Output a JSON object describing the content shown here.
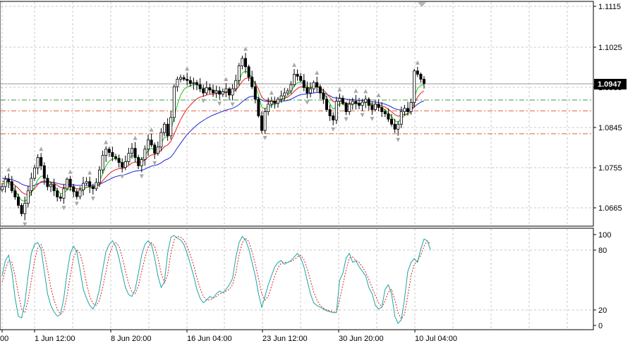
{
  "chart_data": [
    {
      "type": "candlestick",
      "y_ticks": [
        "1.1115",
        "1.1025",
        "1.0935",
        "1.0845",
        "1.0755",
        "1.0665"
      ],
      "ylim": [
        1.0605,
        1.1145
      ],
      "current_price_label": "1.0947",
      "current_price": 1.0947,
      "horizontal_levels": [
        {
          "price": 1.0908,
          "color": "#3c9a3c",
          "style": "dash-dot"
        },
        {
          "price": 1.0882,
          "color": "#e0623a",
          "style": "dash-dot"
        },
        {
          "price": 1.0827,
          "color": "#e0623a",
          "style": "dash-dot"
        }
      ],
      "x_labels": [
        "00",
        "1 Jun 12:00",
        "8 Jun 20:00",
        "16 Jun 04:00",
        "23 Jun 12:00",
        "30 Jun 20:00",
        "10 Jul 04:00"
      ],
      "closes": [
        1.07,
        1.0718,
        1.0712,
        1.069,
        1.0675,
        1.0655,
        1.0635,
        1.066,
        1.069,
        1.072,
        1.0745,
        1.077,
        1.075,
        1.072,
        1.07,
        1.0705,
        1.069,
        1.0675,
        1.0672,
        1.0695,
        1.0718,
        1.07,
        1.0688,
        1.0676,
        1.0692,
        1.0708,
        1.0712,
        1.07,
        1.0695,
        1.071,
        1.074,
        1.0775,
        1.079,
        1.0782,
        1.0772,
        1.0768,
        1.0758,
        1.0746,
        1.076,
        1.078,
        1.0792,
        1.077,
        1.075,
        1.0765,
        1.079,
        1.0812,
        1.08,
        1.078,
        1.0795,
        1.083,
        1.085,
        1.0822,
        1.0866,
        1.094,
        1.0958,
        1.0962,
        1.0958,
        1.0955,
        1.0948,
        1.095,
        1.0945,
        1.0935,
        1.0925,
        1.0938,
        1.0932,
        1.0925,
        1.093,
        1.0922,
        1.0928,
        1.0935,
        1.092,
        1.0935,
        1.0955,
        1.099,
        1.1008,
        1.0988,
        1.0963,
        1.094,
        1.091,
        1.087,
        1.0835,
        1.088,
        1.0898,
        1.0905,
        1.09,
        1.091,
        1.0918,
        1.0925,
        1.093,
        1.0945,
        1.097,
        1.0965,
        1.0955,
        1.0938,
        1.0925,
        1.0935,
        1.095,
        1.094,
        1.0925,
        1.091,
        1.0885,
        1.087,
        1.086,
        1.0905,
        1.0912,
        1.09,
        1.088,
        1.0898,
        1.0905,
        1.09,
        1.0895,
        1.0903,
        1.091,
        1.0895,
        1.0885,
        1.0898,
        1.089,
        1.088,
        1.0875,
        1.0862,
        1.085,
        1.0838,
        1.085,
        1.088,
        1.0888,
        1.088,
        1.0902,
        1.0978,
        1.097,
        1.0958,
        1.0948
      ],
      "ma_fast": [
        1.0706,
        1.071,
        1.0709,
        1.0701,
        1.0691,
        1.0678,
        1.0667,
        1.0665,
        1.067,
        1.0684,
        1.07,
        1.0716,
        1.0725,
        1.0725,
        1.0716,
        1.071,
        1.0702,
        1.0692,
        1.0683,
        1.0684,
        1.0692,
        1.0694,
        1.0691,
        1.0685,
        1.0686,
        1.0692,
        1.0698,
        1.0699,
        1.0697,
        1.0701,
        1.0712,
        1.0731,
        1.075,
        1.0761,
        1.0766,
        1.0767,
        1.0763,
        1.0756,
        1.0757,
        1.0766,
        1.0775,
        1.0773,
        1.0766,
        1.0766,
        1.0774,
        1.0787,
        1.0792,
        1.0788,
        1.079,
        1.0803,
        1.0818,
        1.082,
        1.0833,
        1.0867,
        1.0897,
        1.092,
        1.0933,
        1.094,
        1.0942,
        1.0945,
        1.0945,
        1.0941,
        1.0936,
        1.0936,
        1.0935,
        1.0931,
        1.0931,
        1.0928,
        1.0928,
        1.093,
        1.0927,
        1.0929,
        1.0938,
        1.0955,
        1.0973,
        1.0978,
        1.0973,
        1.0962,
        1.0944,
        1.0919,
        1.0891,
        1.0887,
        1.0891,
        1.0896,
        1.0897,
        1.0901,
        1.0907,
        1.0913,
        1.0919,
        1.0928,
        1.0942,
        1.095,
        1.0952,
        1.0947,
        1.094,
        1.0938,
        1.0942,
        1.0941,
        1.0936,
        1.0927,
        1.0913,
        1.0899,
        1.0886,
        1.0892,
        1.0899,
        1.0899,
        1.0893,
        1.0895,
        1.0898,
        1.0899,
        1.0897,
        1.0899,
        1.0903,
        1.09,
        1.0895,
        1.0896,
        1.0894,
        1.0889,
        1.0884,
        1.0877,
        1.0868,
        1.0858,
        1.0855,
        1.0863,
        1.0871,
        1.0874,
        1.0883,
        1.0915,
        1.0936,
        1.0943,
        1.0945
      ],
      "ma_mid": [
        1.0712,
        1.0713,
        1.0712,
        1.0708,
        1.0703,
        1.0696,
        1.0687,
        1.0682,
        1.0682,
        1.0687,
        1.0695,
        1.0705,
        1.0712,
        1.0714,
        1.0712,
        1.0711,
        1.0708,
        1.0703,
        1.0698,
        1.0697,
        1.0699,
        1.0699,
        1.0698,
        1.0695,
        1.0695,
        1.0697,
        1.0699,
        1.0699,
        1.0699,
        1.07,
        1.0705,
        1.0714,
        1.0723,
        1.0731,
        1.0737,
        1.0741,
        1.0743,
        1.0743,
        1.0746,
        1.0751,
        1.0757,
        1.0759,
        1.0758,
        1.0759,
        1.0764,
        1.0771,
        1.0776,
        1.0777,
        1.078,
        1.0787,
        1.0796,
        1.08,
        1.0809,
        1.0826,
        1.0844,
        1.0861,
        1.0875,
        1.0887,
        1.0896,
        1.0904,
        1.0911,
        1.0915,
        1.0917,
        1.092,
        1.0922,
        1.0922,
        1.0924,
        1.0924,
        1.0925,
        1.0926,
        1.0926,
        1.0927,
        1.0932,
        1.0942,
        1.0953,
        1.096,
        1.0961,
        1.0958,
        1.0949,
        1.0934,
        1.0915,
        1.0908,
        1.0906,
        1.0906,
        1.0905,
        1.0906,
        1.0909,
        1.0912,
        1.0915,
        1.0921,
        1.0929,
        1.0936,
        1.094,
        1.0939,
        1.0937,
        1.0937,
        1.0939,
        1.0939,
        1.0937,
        1.0932,
        1.0924,
        1.0914,
        1.0904,
        1.0904,
        1.0905,
        1.0904,
        1.09,
        1.09,
        1.0901,
        1.0901,
        1.09,
        1.0901,
        1.0903,
        1.0901,
        1.0898,
        1.0898,
        1.0897,
        1.0894,
        1.0891,
        1.0886,
        1.088,
        1.0873,
        1.0869,
        1.0871,
        1.0874,
        1.0875,
        1.088,
        1.09,
        1.0915,
        1.0925,
        1.093
      ],
      "ma_slow": [
        1.072,
        1.072,
        1.0719,
        1.0717,
        1.0714,
        1.0711,
        1.0706,
        1.0703,
        1.0701,
        1.0701,
        1.0703,
        1.0707,
        1.071,
        1.0711,
        1.0711,
        1.0711,
        1.071,
        1.0708,
        1.0706,
        1.0705,
        1.0705,
        1.0705,
        1.0704,
        1.0703,
        1.0703,
        1.0703,
        1.0703,
        1.0703,
        1.0703,
        1.0703,
        1.0705,
        1.0709,
        1.0713,
        1.0717,
        1.0721,
        1.0724,
        1.0726,
        1.0727,
        1.0729,
        1.0732,
        1.0735,
        1.0737,
        1.0738,
        1.0739,
        1.0742,
        1.0746,
        1.0749,
        1.0751,
        1.0753,
        1.0757,
        1.0763,
        1.0766,
        1.0771,
        1.0781,
        1.0793,
        1.0804,
        1.0815,
        1.0825,
        1.0833,
        1.0841,
        1.0848,
        1.0854,
        1.0859,
        1.0864,
        1.0868,
        1.0872,
        1.0875,
        1.0878,
        1.0881,
        1.0884,
        1.0886,
        1.0888,
        1.0892,
        1.0897,
        1.0904,
        1.091,
        1.0915,
        1.0917,
        1.0917,
        1.0913,
        1.0908,
        1.0905,
        1.0904,
        1.0904,
        1.0904,
        1.0904,
        1.0905,
        1.0906,
        1.0907,
        1.091,
        1.0914,
        1.0918,
        1.0921,
        1.0922,
        1.0923,
        1.0924,
        1.0925,
        1.0926,
        1.0926,
        1.0925,
        1.0922,
        1.0918,
        1.0914,
        1.0913,
        1.0913,
        1.0912,
        1.091,
        1.0909,
        1.0909,
        1.0908,
        1.0907,
        1.0907,
        1.0907,
        1.0906,
        1.0904,
        1.0903,
        1.0902,
        1.09,
        1.0898,
        1.0895,
        1.0891,
        1.0887,
        1.0885,
        1.0884,
        1.0884,
        1.0883,
        1.0884,
        1.0891,
        1.0898,
        1.0903,
        1.0906
      ],
      "ma_colors": {
        "fast": "#19c419",
        "mid": "#e01e1e",
        "slow": "#1c27d6"
      },
      "candle_color": "#000000"
    },
    {
      "type": "line",
      "name": "stochastic",
      "y_ticks": [
        "100",
        "80",
        "20",
        "0"
      ],
      "ylim": [
        -5,
        108
      ],
      "levels": [
        80,
        20
      ],
      "main_color": "#1ea3a3",
      "signal_color": "#d62020",
      "main_values": [
        55,
        72,
        78,
        60,
        30,
        10,
        8,
        25,
        55,
        80,
        90,
        92,
        85,
        60,
        35,
        22,
        15,
        10,
        12,
        30,
        58,
        80,
        88,
        82,
        62,
        40,
        30,
        22,
        18,
        26,
        40,
        62,
        82,
        90,
        94,
        88,
        75,
        58,
        42,
        34,
        32,
        40,
        58,
        78,
        90,
        94,
        90,
        75,
        55,
        42,
        48,
        80,
        98,
        100,
        97,
        95,
        90,
        80,
        68,
        55,
        40,
        30,
        25,
        28,
        32,
        30,
        35,
        38,
        36,
        40,
        45,
        52,
        75,
        92,
        99,
        95,
        85,
        70,
        55,
        35,
        20,
        32,
        45,
        55,
        65,
        70,
        72,
        68,
        70,
        72,
        76,
        80,
        75,
        65,
        50,
        35,
        25,
        22,
        20,
        18,
        16,
        15,
        14,
        14,
        50,
        58,
        75,
        80,
        70,
        72,
        65,
        60,
        55,
        42,
        35,
        22,
        18,
        20,
        40,
        45,
        35,
        10,
        2,
        6,
        30,
        60,
        70,
        74,
        70,
        85,
        96,
        94,
        84
      ],
      "signal_values": [
        48,
        62,
        72,
        70,
        55,
        35,
        18,
        14,
        28,
        50,
        72,
        86,
        90,
        80,
        62,
        42,
        28,
        18,
        12,
        16,
        33,
        55,
        75,
        84,
        80,
        66,
        46,
        32,
        24,
        22,
        28,
        42,
        60,
        78,
        88,
        92,
        88,
        76,
        60,
        46,
        37,
        35,
        44,
        60,
        75,
        87,
        92,
        88,
        75,
        58,
        47,
        56,
        80,
        95,
        99,
        98,
        95,
        88,
        78,
        67,
        53,
        41,
        32,
        28,
        28,
        30,
        32,
        35,
        36,
        38,
        40,
        45,
        58,
        78,
        92,
        97,
        93,
        82,
        68,
        52,
        35,
        28,
        32,
        43,
        55,
        64,
        69,
        70,
        70,
        71,
        73,
        76,
        78,
        73,
        63,
        50,
        37,
        28,
        22,
        19,
        17,
        16,
        15,
        14,
        28,
        45,
        62,
        75,
        76,
        72,
        70,
        65,
        59,
        51,
        42,
        33,
        25,
        20,
        27,
        37,
        40,
        28,
        14,
        7,
        12,
        33,
        55,
        68,
        72,
        78,
        88,
        94,
        90
      ]
    }
  ]
}
